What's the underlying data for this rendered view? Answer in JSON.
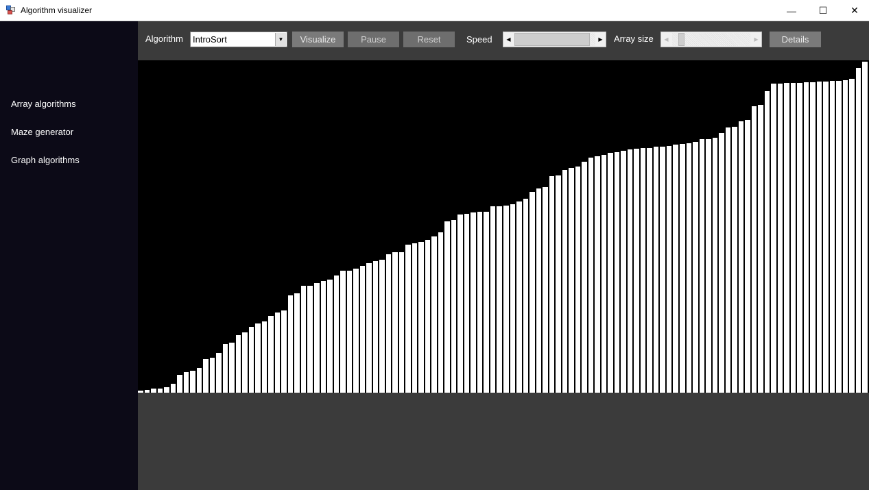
{
  "window": {
    "title": "Algorithm visualizer",
    "controls": [
      "—",
      "☐",
      "✕"
    ]
  },
  "sidebar": {
    "items": [
      {
        "label": "Array algorithms"
      },
      {
        "label": "Maze generator"
      },
      {
        "label": "Graph algorithms"
      }
    ]
  },
  "toolbar": {
    "algorithm_label": "Algorithm",
    "algorithm_selected": "IntroSort",
    "visualize_label": "Visualize",
    "pause_label": "Pause",
    "reset_label": "Reset",
    "speed_label": "Speed",
    "array_size_label": "Array size",
    "details_label": "Details"
  },
  "chart_data": {
    "type": "bar",
    "max_value": 483,
    "values": [
      3,
      4,
      6,
      6,
      8,
      13,
      26,
      30,
      32,
      36,
      49,
      51,
      58,
      71,
      73,
      84,
      88,
      96,
      101,
      104,
      112,
      117,
      120,
      142,
      145,
      156,
      156,
      160,
      163,
      165,
      171,
      178,
      178,
      181,
      185,
      189,
      192,
      194,
      202,
      205,
      205,
      216,
      218,
      220,
      223,
      228,
      234,
      250,
      252,
      260,
      261,
      263,
      264,
      264,
      272,
      272,
      273,
      275,
      279,
      283,
      293,
      298,
      300,
      316,
      317,
      325,
      328,
      330,
      337,
      343,
      345,
      347,
      350,
      351,
      353,
      355,
      356,
      357,
      357,
      359,
      359,
      360,
      362,
      363,
      364,
      366,
      370,
      370,
      372,
      379,
      387,
      388,
      396,
      398,
      418,
      420,
      440,
      451,
      451,
      452,
      452,
      452,
      453,
      453,
      454,
      454,
      455,
      455,
      456,
      458,
      474,
      483
    ]
  }
}
